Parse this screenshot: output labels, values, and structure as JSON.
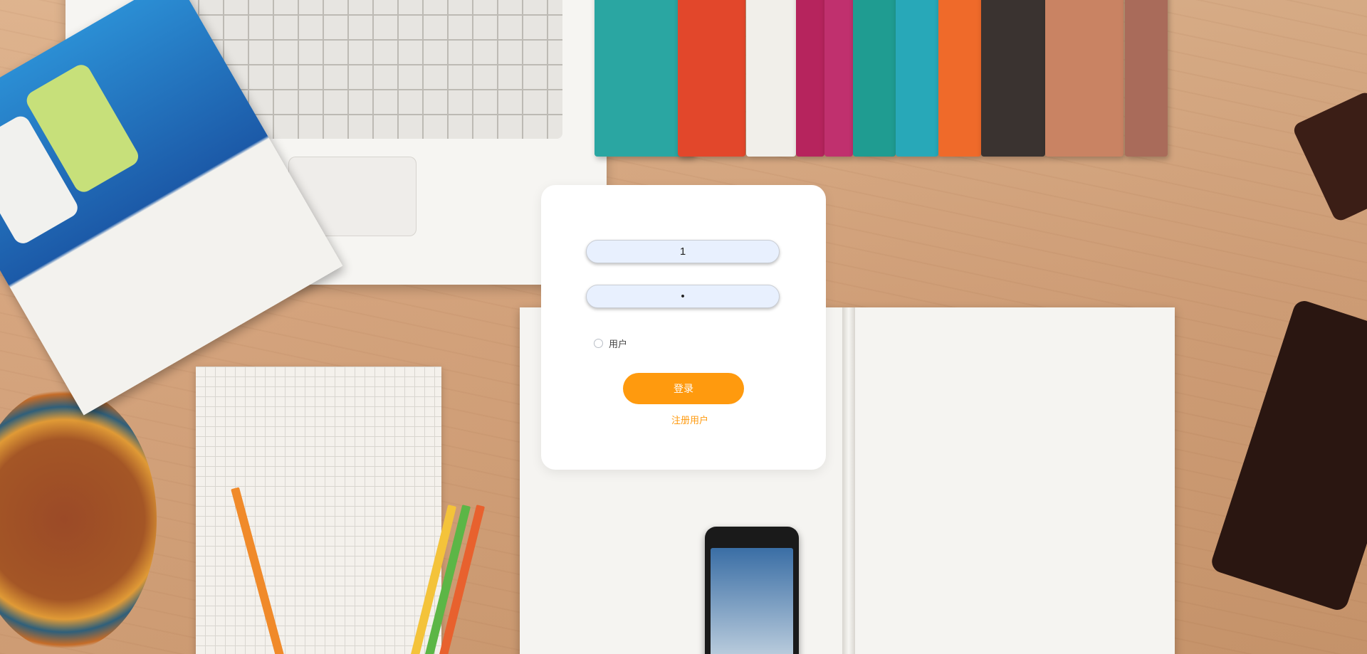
{
  "login": {
    "username_value": "1",
    "password_value": "1",
    "role_label": "用户",
    "login_button_label": "登录",
    "register_link_label": "注册用户"
  },
  "colors": {
    "accent": "#ff9a0e",
    "input_background": "#e8f0fe",
    "card_background": "#ffffff"
  }
}
